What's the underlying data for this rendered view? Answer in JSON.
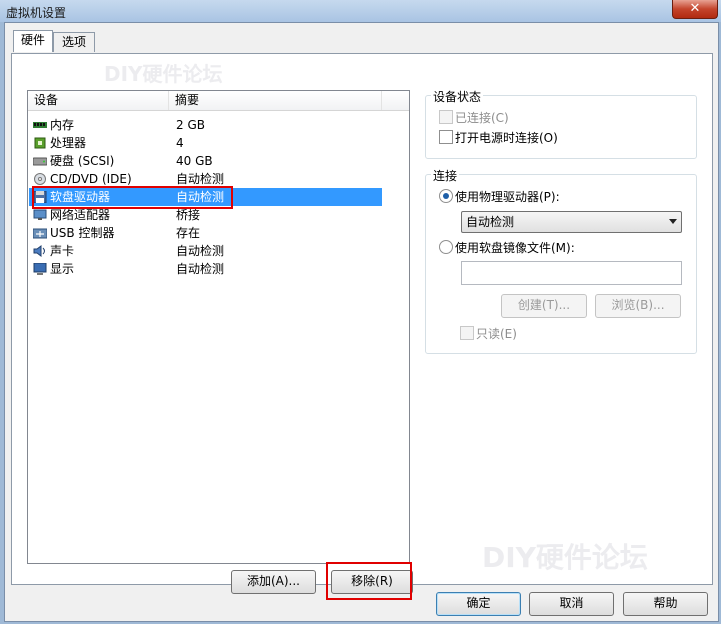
{
  "window": {
    "title": "虚拟机设置",
    "close_glyph": "✕"
  },
  "tabs": [
    {
      "label": "硬件",
      "active": true
    },
    {
      "label": "选项",
      "active": false
    }
  ],
  "device_list": {
    "columns": [
      "设备",
      "摘要"
    ],
    "rows": [
      {
        "device": "内存",
        "summary": "2 GB",
        "icon": "memory-icon"
      },
      {
        "device": "处理器",
        "summary": "4",
        "icon": "processor-icon"
      },
      {
        "device": "硬盘 (SCSI)",
        "summary": "40 GB",
        "icon": "hard-disk-icon"
      },
      {
        "device": "CD/DVD (IDE)",
        "summary": "自动检测",
        "icon": "cd-dvd-icon"
      },
      {
        "device": "软盘驱动器",
        "summary": "自动检测",
        "icon": "floppy-icon",
        "selected": true
      },
      {
        "device": "网络适配器",
        "summary": "桥接",
        "icon": "network-adapter-icon"
      },
      {
        "device": "USB 控制器",
        "summary": "存在",
        "icon": "usb-icon"
      },
      {
        "device": "声卡",
        "summary": "自动检测",
        "icon": "sound-card-icon"
      },
      {
        "device": "显示",
        "summary": "自动检测",
        "icon": "display-icon"
      }
    ]
  },
  "list_buttons": {
    "add": "添加(A)...",
    "remove": "移除(R)"
  },
  "device_status": {
    "title": "设备状态",
    "connected": "已连接(C)",
    "connect_at_power_on": "打开电源时连接(O)"
  },
  "connection": {
    "title": "连接",
    "use_physical_drive": "使用物理驱动器(P):",
    "drive_select_value": "自动检测",
    "use_image_file": "使用软盘镜像文件(M):",
    "image_path_value": "",
    "create_button": "创建(T)...",
    "browse_button": "浏览(B)...",
    "readonly": "只读(E)"
  },
  "footer": {
    "ok": "确定",
    "cancel": "取消",
    "help": "帮助"
  },
  "watermark": {
    "text_top": "DIY硬件论坛",
    "text_bottom": "DIY硬件论坛"
  },
  "colors": {
    "selection": "#3399ff",
    "highlight_box": "#e00000",
    "close_button": "#c4442c"
  }
}
